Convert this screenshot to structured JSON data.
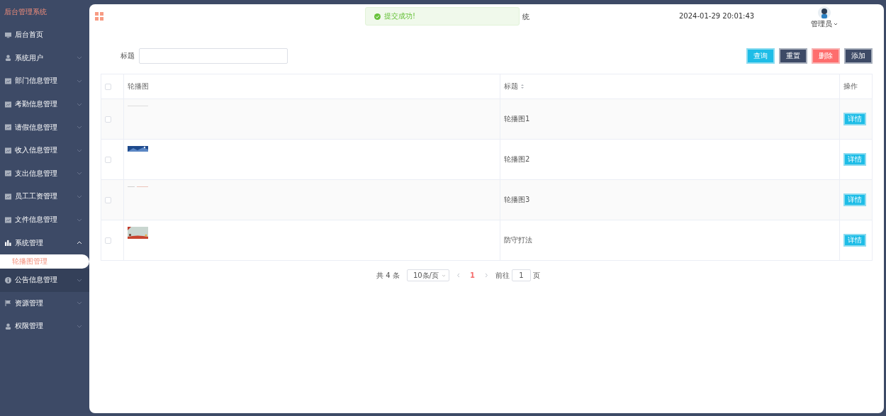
{
  "sidebar": {
    "title": "后台管理系统",
    "items": [
      {
        "label": "后台首页",
        "kind": "monitor",
        "hovered": false
      },
      {
        "label": "系统用户",
        "kind": "user",
        "expanded": false,
        "hovered": false
      },
      {
        "label": "部门信息管理",
        "kind": "chart",
        "expanded": false,
        "hovered": false
      },
      {
        "label": "考勤信息管理",
        "kind": "chart",
        "expanded": false,
        "hovered": false
      },
      {
        "label": "请假信息管理",
        "kind": "chart",
        "expanded": false,
        "hovered": false
      },
      {
        "label": "收入信息管理",
        "kind": "chart",
        "expanded": false,
        "hovered": false
      },
      {
        "label": "支出信息管理",
        "kind": "chart",
        "expanded": false,
        "hovered": false
      },
      {
        "label": "员工工资管理",
        "kind": "chart",
        "expanded": false,
        "hovered": false
      },
      {
        "label": "文件信息管理",
        "kind": "chart",
        "expanded": false,
        "hovered": false
      },
      {
        "label": "系统管理",
        "kind": "bars",
        "expanded": true,
        "hovered": false,
        "children": [
          {
            "label": "轮播图管理",
            "selected": true
          }
        ]
      },
      {
        "label": "公告信息管理",
        "kind": "info",
        "expanded": false,
        "hovered": true
      },
      {
        "label": "资源管理",
        "kind": "flag",
        "expanded": false,
        "hovered": false
      },
      {
        "label": "权限管理",
        "kind": "user",
        "expanded": false,
        "hovered": false
      }
    ]
  },
  "header": {
    "title": "统",
    "datetime": "2024-01-29 20:01:43",
    "user": "管理员"
  },
  "toast": {
    "message": "提交成功!"
  },
  "search": {
    "label": "标题",
    "buttons": [
      {
        "label": "查询",
        "kind": "primary"
      },
      {
        "label": "重置",
        "kind": "dark"
      },
      {
        "label": "删除",
        "kind": "danger"
      },
      {
        "label": "添加",
        "kind": "dark"
      }
    ]
  },
  "table": {
    "all_checked": false,
    "columns": [
      "轮播图",
      "标题",
      "操作"
    ],
    "rows": [
      {
        "checked": false,
        "title": "轮播图1",
        "action": "详情"
      },
      {
        "checked": false,
        "title": "轮播图2",
        "action": "详情"
      },
      {
        "checked": false,
        "title": "轮播图3",
        "action": "详情"
      },
      {
        "checked": false,
        "title": "防守打法",
        "action": "详情"
      }
    ]
  },
  "pagination": {
    "total": "共 4 条",
    "page_size": "10条/页",
    "pages": [
      {
        "label": "1",
        "selected": true
      }
    ],
    "goto_label": "前往",
    "goto_value": "1",
    "goto_suffix": "页"
  }
}
